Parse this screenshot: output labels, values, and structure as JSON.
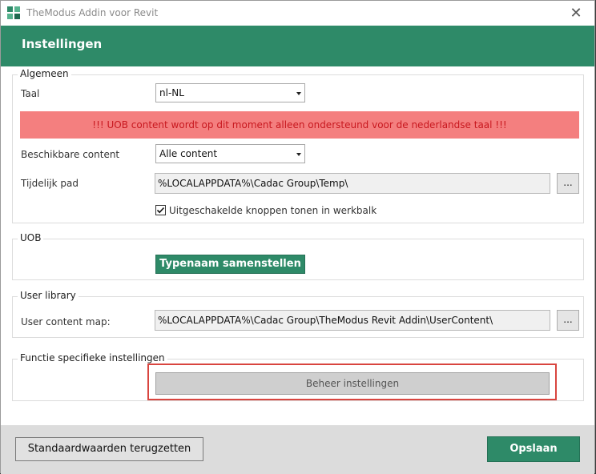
{
  "window": {
    "title": "TheModus Addin voor Revit",
    "close_symbol": "✕"
  },
  "header": {
    "title": "Instellingen"
  },
  "algemeen": {
    "group_title": "Algemeen",
    "taal_label": "Taal",
    "taal_value": "nl-NL",
    "warning": "!!! UOB content wordt op dit moment alleen ondersteund voor de nederlandse taal !!!",
    "content_label": "Beschikbare content",
    "content_value": "Alle content",
    "pad_label": "Tijdelijk pad",
    "pad_value": "%LOCALAPPDATA%\\Cadac Group\\Temp\\",
    "browse_label": "...",
    "checkbox_label": "Uitgeschakelde knoppen tonen in werkbalk",
    "checkbox_checked": true
  },
  "uob": {
    "group_title": "UOB",
    "button_label": "Typenaam samenstellen"
  },
  "user_library": {
    "group_title": "User library",
    "map_label": "User content map:",
    "map_value": "%LOCALAPPDATA%\\Cadac Group\\TheModus Revit Addin\\UserContent\\",
    "browse_label": "..."
  },
  "functie": {
    "group_title": "Functie specifieke instellingen",
    "button_label": "Beheer instellingen"
  },
  "footer": {
    "reset_label": "Standaardwaarden terugzetten",
    "save_label": "Opslaan"
  },
  "colors": {
    "brand_green": "#2e8a68",
    "warning_bg": "#f47f7f",
    "warning_text": "#c8181f",
    "highlight": "#d9453f"
  }
}
